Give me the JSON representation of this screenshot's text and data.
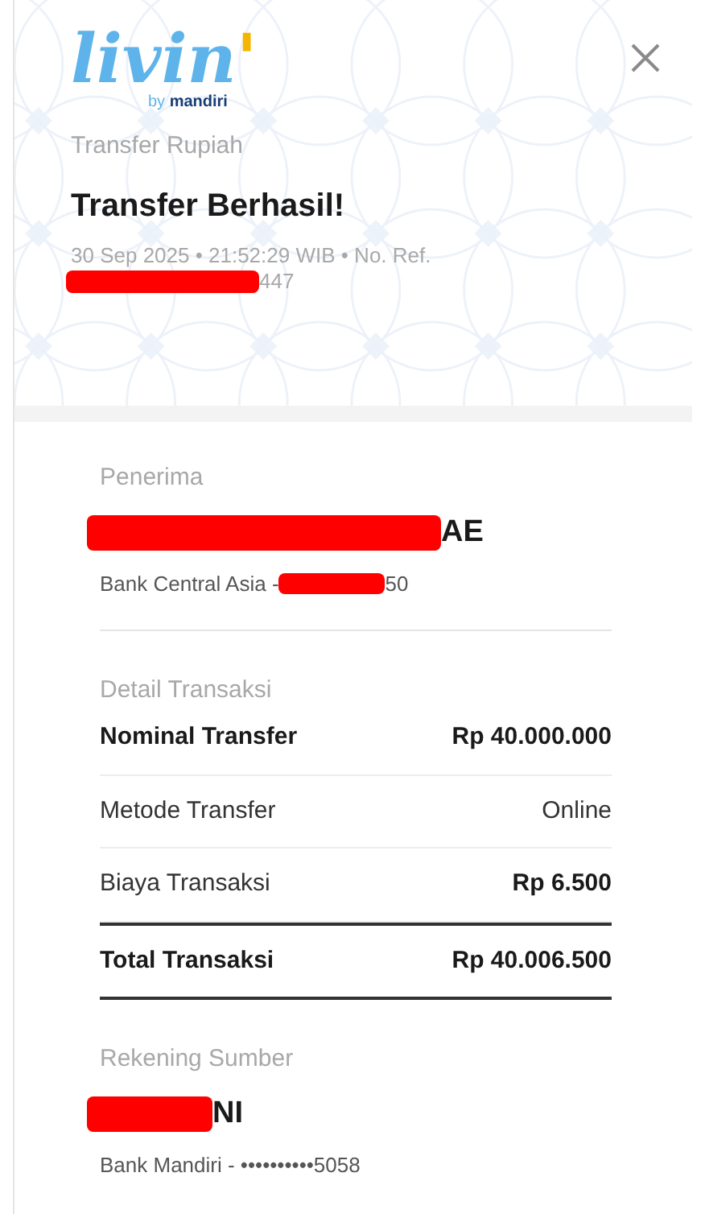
{
  "logo": {
    "word": "livin",
    "accent": "'",
    "byline_prefix": "by",
    "byline_brand": "mandiri"
  },
  "header": {
    "subtitle": "Transfer Rupiah",
    "title": "Transfer Berhasil!",
    "meta": "30 Sep 2025 • 21:52:29 WIB • No. Ref.",
    "ref_suffix": "447",
    "ref_redacted": true
  },
  "recipient": {
    "label": "Penerima",
    "name_suffix": "AE",
    "name_redacted": true,
    "account_prefix": "Bank Central Asia -",
    "account_suffix": "50",
    "account_redacted": true
  },
  "details": {
    "label": "Detail Transaksi",
    "rows": [
      {
        "label": "Nominal Transfer",
        "value": "Rp 40.000.000",
        "bold_label": true,
        "bold_value": true,
        "total": false
      },
      {
        "label": "Metode Transfer",
        "value": "Online",
        "bold_label": false,
        "bold_value": false,
        "total": false
      },
      {
        "label": "Biaya Transaksi",
        "value": "Rp 6.500",
        "bold_label": false,
        "bold_value": true,
        "total": false
      },
      {
        "label": "Total Transaksi",
        "value": "Rp 40.006.500",
        "bold_label": true,
        "bold_value": true,
        "total": true
      }
    ]
  },
  "source": {
    "label": "Rekening Sumber",
    "name_suffix": "NI",
    "name_redacted": true,
    "account": "Bank Mandiri - ••••••••••5058"
  }
}
